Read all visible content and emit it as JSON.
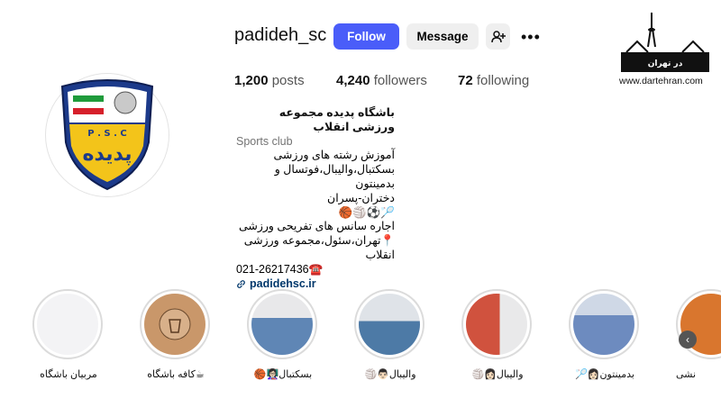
{
  "profile": {
    "username": "padideh_sc",
    "follow_label": "Follow",
    "message_label": "Message",
    "add_user_icon": "person-add-icon",
    "more_label": "•••",
    "stats": {
      "posts_count": "1,200",
      "posts_label": "posts",
      "followers_count": "4,240",
      "followers_label": "followers",
      "following_count": "72",
      "following_label": "following"
    },
    "avatar": {
      "letters": "P . S . C",
      "text": "پدیده"
    },
    "bio": {
      "name": "باشگاه پدیده مجموعه ورزشی انقلاب",
      "category": "Sports club",
      "lines": [
        "آموزش رشته های ورزشی",
        "بسکتبال،والیبال،فوتسال و بدمینتون",
        "دختران-پسران",
        "🏸⚽🏐🏀",
        "اجاره سانس های تفریحی ورزشی",
        "📍تهران،سئول،مجموعه ورزشی انقلاب",
        "021-26217436☎️"
      ],
      "link": "padidehsc.ir"
    }
  },
  "watermark": {
    "text": "در تهران",
    "url": "www.dartehran.com"
  },
  "highlights": [
    {
      "label": "مربیان باشگاه",
      "bg": "#f3f3f5"
    },
    {
      "label": "☕کافه باشگاه",
      "bg": "#c9976a"
    },
    {
      "label": "بسکتبال👩🏻‍🏫🏀",
      "bg": "#8aa0b8"
    },
    {
      "label": "والیبال👨🏻🏐",
      "bg": "#6f8fa8"
    },
    {
      "label": "والیبال👩🏻🏐",
      "bg": "#c96a55"
    },
    {
      "label": "بدمینتون👩🏻🏸",
      "bg": "#7d92b4"
    },
    {
      "label": "نشی",
      "bg": "#d9762e"
    }
  ],
  "scroll_arrow": "‹"
}
